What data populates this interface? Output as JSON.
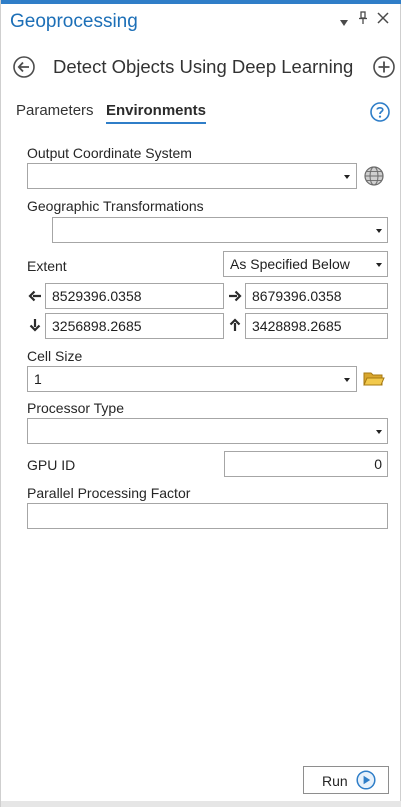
{
  "pane": {
    "title": "Geoprocessing",
    "menu_icon": "dropdown-triangle-icon",
    "pin_icon": "pin-icon",
    "close_icon": "close-icon"
  },
  "header": {
    "back_icon": "back-arrow-circle-icon",
    "tool_title": "Detect Objects Using Deep Learning",
    "add_icon": "add-circle-icon"
  },
  "tabs": [
    {
      "label": "Parameters",
      "active": false
    },
    {
      "label": "Environments",
      "active": true
    }
  ],
  "help_icon": "help-circle-icon",
  "environments": {
    "output_coordinate_system": {
      "label": "Output Coordinate System",
      "value": "",
      "globe_icon": "globe-icon"
    },
    "geographic_transformations": {
      "label": "Geographic Transformations",
      "value": ""
    },
    "extent": {
      "label": "Extent",
      "mode": "As Specified Below",
      "left": "8529396.0358",
      "right": "8679396.0358",
      "bottom": "3256898.2685",
      "top": "3428898.2685"
    },
    "cell_size": {
      "label": "Cell Size",
      "value": "1",
      "folder_icon": "folder-icon"
    },
    "processor_type": {
      "label": "Processor Type",
      "value": ""
    },
    "gpu_id": {
      "label": "GPU ID",
      "value": "0"
    },
    "parallel_processing_factor": {
      "label": "Parallel Processing Factor",
      "value": ""
    }
  },
  "footer": {
    "run_label": "Run",
    "run_icon": "play-circle-icon"
  },
  "colors": {
    "accent": "#2f7ec8",
    "title": "#1c6fb7"
  }
}
